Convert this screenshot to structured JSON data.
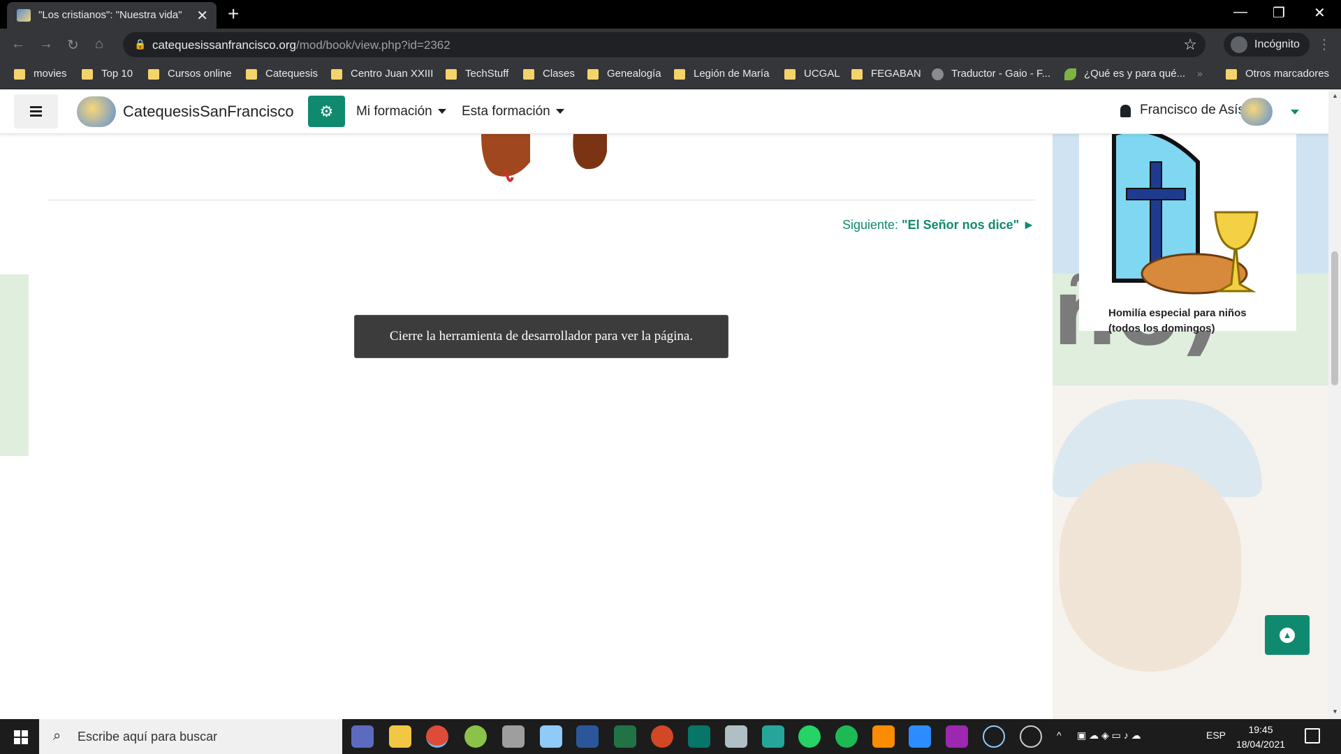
{
  "browser": {
    "tab_title": "\"Los cristianos\": \"Nuestra vida\"",
    "url_domain": "catequesissanfrancisco.org",
    "url_path": "/mod/book/view.php?id=2362",
    "incognito_label": "Incógnito",
    "bookmarks": [
      "movies",
      "Top 10",
      "Cursos online",
      "Catequesis",
      "Centro Juan XXIII",
      "TechStuff",
      "Clases",
      "Genealogía",
      "Legión de María",
      "UCGAL",
      "FEGABAN",
      "Traductor - Gaio - F...",
      "¿Qué es y para qué...",
      "Otros marcadores"
    ],
    "more_bookmarks": "»"
  },
  "header": {
    "site_name": "CatequesisSanFrancisco",
    "menu_my_training": "Mi formación",
    "menu_this_training": "Esta formación",
    "user_name": "Francisco de Asís"
  },
  "content": {
    "next_prefix": "Siguiente:",
    "next_title": "\"El Señor nos dice\"",
    "devtools_message": "Cierre la herramienta de desarrollador para ver la página.",
    "sidebar_caption": "Homilía especial para niños (todos los domingos)",
    "background_text": "ño)"
  },
  "taskbar": {
    "search_placeholder": "Escribe aquí para buscar",
    "language": "ESP",
    "time": "19:45",
    "date": "18/04/2021"
  },
  "colors": {
    "accent": "#0f8a6f",
    "chrome_dark": "#35363a",
    "taskbar": "#1c1c1c"
  }
}
